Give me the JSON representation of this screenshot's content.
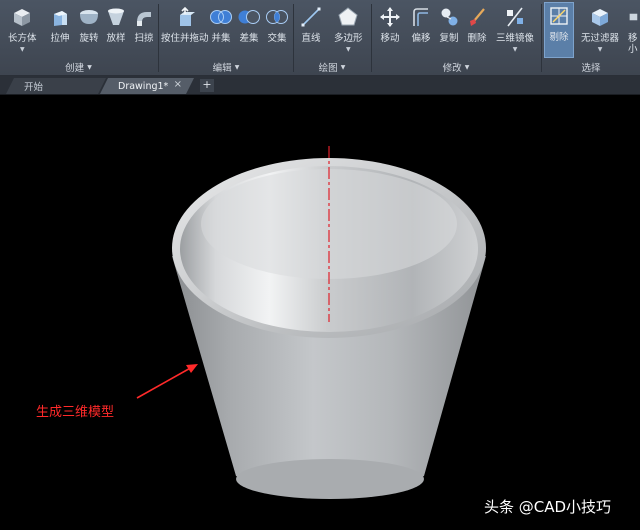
{
  "ribbon": {
    "create": {
      "tools": [
        {
          "label": "长方体",
          "icon": "box-icon"
        },
        {
          "label": "拉伸",
          "icon": "extrude-icon"
        },
        {
          "label": "旋转",
          "icon": "revolve-icon"
        },
        {
          "label": "放样",
          "icon": "loft-icon"
        },
        {
          "label": "扫掠",
          "icon": "sweep-icon"
        }
      ],
      "panel_label": "创建"
    },
    "edit": {
      "tools": [
        {
          "label": "按住并拖动",
          "icon": "presspull-icon"
        },
        {
          "label": "并集",
          "icon": "union-icon"
        },
        {
          "label": "差集",
          "icon": "subtract-icon"
        },
        {
          "label": "交集",
          "icon": "intersect-icon"
        }
      ],
      "panel_label": "编辑"
    },
    "draw": {
      "tools": [
        {
          "label": "直线",
          "icon": "line-icon"
        },
        {
          "label": "多边形",
          "icon": "polygon-icon"
        }
      ],
      "panel_label": "绘图"
    },
    "modify": {
      "tools": [
        {
          "label": "移动",
          "icon": "move-icon"
        },
        {
          "label": "偏移",
          "icon": "offset-icon"
        },
        {
          "label": "复制",
          "icon": "copy-icon"
        },
        {
          "label": "删除",
          "icon": "erase-icon"
        },
        {
          "label": "三维镜像",
          "icon": "mirror3d-icon"
        }
      ],
      "panel_label": "修改"
    },
    "select": {
      "tools": [
        {
          "label": "剔除",
          "icon": "culling-icon"
        },
        {
          "label": "无过滤器",
          "icon": "filter-icon"
        },
        {
          "label": "移",
          "sublabel": "小",
          "icon": "gizmo-icon"
        }
      ],
      "panel_label": "选择"
    }
  },
  "tabs": [
    {
      "label": "开始"
    },
    {
      "label": "Drawing1*"
    }
  ],
  "tab_add_label": "+",
  "tab_close_label": "×",
  "annotation": "生成三维模型",
  "watermark": "头条 @CAD小技巧",
  "colors": {
    "annotation": "#ff2a2a",
    "centerline": "#e0202a",
    "ribbon": "#444b55",
    "viewport": "#000000"
  }
}
